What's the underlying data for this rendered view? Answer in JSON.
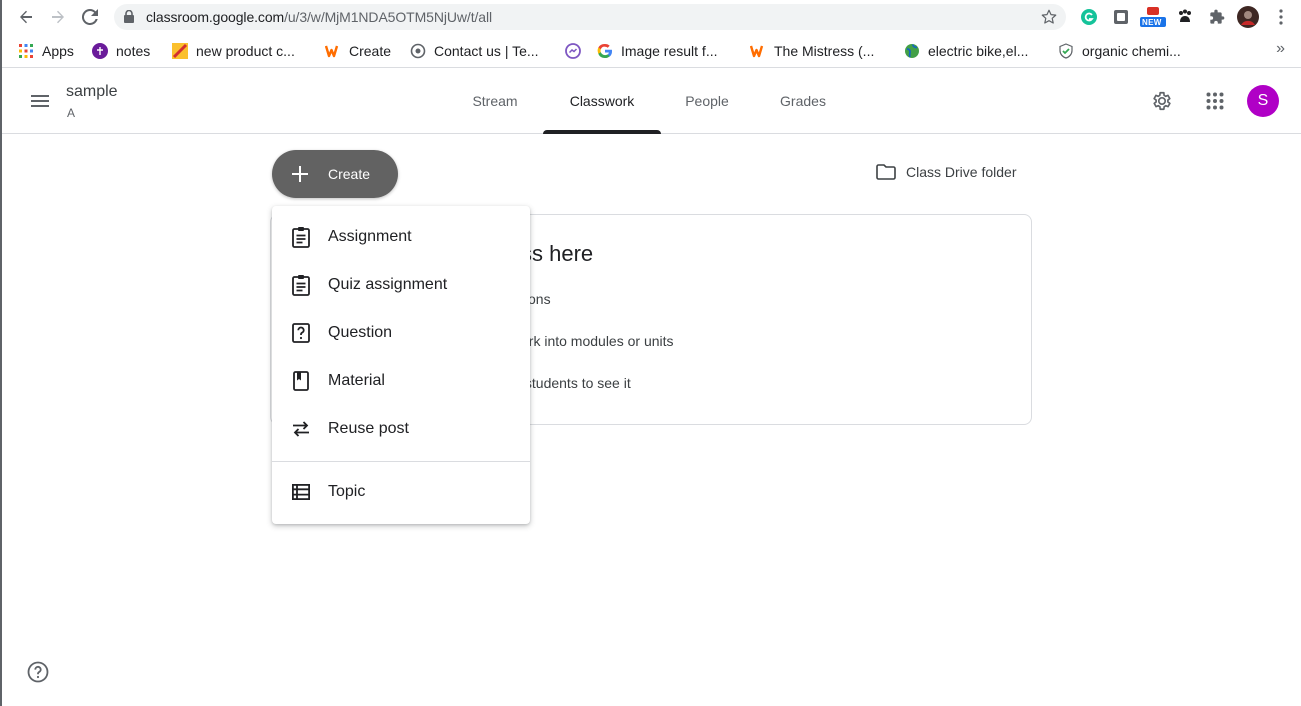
{
  "browser": {
    "url_host": "classroom.google.com",
    "url_path": "/u/3/w/MjM1NDA5OTM5NjUw/t/all",
    "new_badge": "NEW"
  },
  "bookmarks": [
    {
      "label": "Apps",
      "icon": "apps-grid-icon"
    },
    {
      "label": "notes",
      "icon": "notes-icon"
    },
    {
      "label": "new product c...",
      "icon": "product-icon"
    },
    {
      "label": "Create",
      "icon": "wattpad-icon"
    },
    {
      "label": "Contact us | Te...",
      "icon": "contact-icon"
    },
    {
      "label": "Image result f...",
      "icon": "google-icon"
    },
    {
      "label": "The Mistress (...",
      "icon": "wattpad-icon"
    },
    {
      "label": "electric bike,el...",
      "icon": "globe-icon"
    },
    {
      "label": "organic chemi...",
      "icon": "shield-check-icon"
    }
  ],
  "bookmarks_more": "»",
  "header": {
    "class_name": "sample",
    "class_section": "A",
    "tabs": [
      {
        "label": "Stream",
        "active": false
      },
      {
        "label": "Classwork",
        "active": true
      },
      {
        "label": "People",
        "active": false
      },
      {
        "label": "Grades",
        "active": false
      }
    ],
    "avatar_letter": "S"
  },
  "main": {
    "create_label": "Create",
    "drive_label": "Class Drive folder",
    "empty_title": "ss here",
    "empty_lines": [
      "tions",
      "ork into modules or units",
      " students to see it"
    ]
  },
  "create_menu": {
    "items": [
      {
        "label": "Assignment",
        "icon": "assignment-icon"
      },
      {
        "label": "Quiz assignment",
        "icon": "quiz-assignment-icon"
      },
      {
        "label": "Question",
        "icon": "question-icon"
      },
      {
        "label": "Material",
        "icon": "material-icon"
      },
      {
        "label": "Reuse post",
        "icon": "reuse-post-icon"
      },
      {
        "label": "Topic",
        "icon": "topic-icon"
      }
    ]
  },
  "colors": {
    "avatar": "#b000c6",
    "create_button": "#626262",
    "active_tab_indicator": "#202124"
  }
}
